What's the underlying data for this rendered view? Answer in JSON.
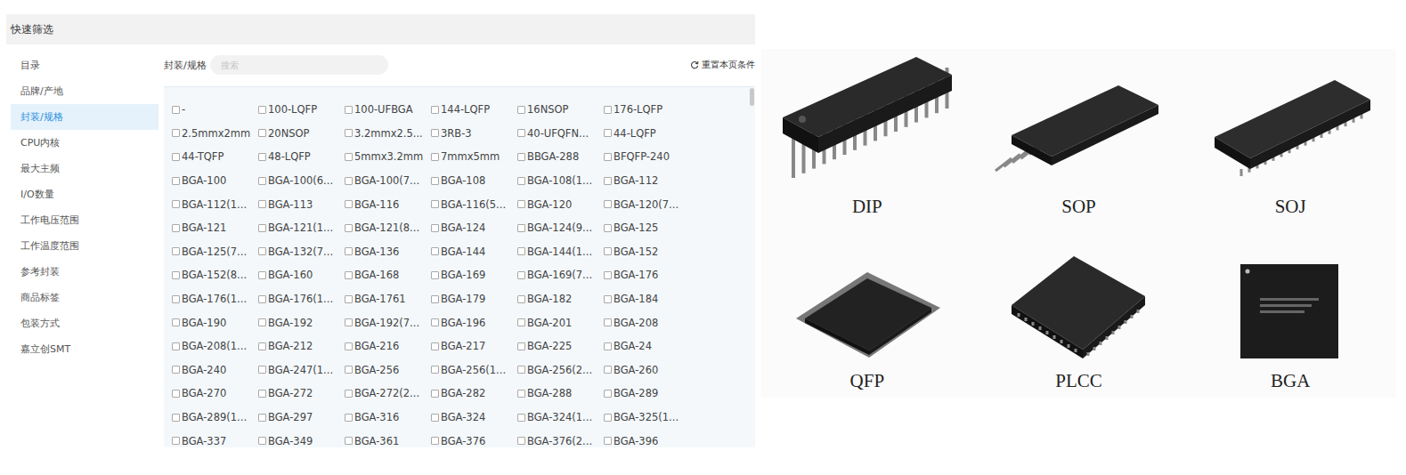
{
  "header": {
    "title": "快速筛选"
  },
  "sidebar": {
    "items": [
      {
        "label": "目录",
        "selected": false
      },
      {
        "label": "品牌/产地",
        "selected": false
      },
      {
        "label": "封装/规格",
        "selected": true
      },
      {
        "label": "CPU内核",
        "selected": false
      },
      {
        "label": "最大主频",
        "selected": false
      },
      {
        "label": "I/O数量",
        "selected": false
      },
      {
        "label": "工作电压范围",
        "selected": false
      },
      {
        "label": "工作温度范围",
        "selected": false
      },
      {
        "label": "参考封装",
        "selected": false
      },
      {
        "label": "商品标签",
        "selected": false
      },
      {
        "label": "包装方式",
        "selected": false
      },
      {
        "label": "嘉立创SMT",
        "selected": false
      }
    ]
  },
  "filter": {
    "label": "封装/规格",
    "search": {
      "placeholder": "搜索"
    },
    "reset": {
      "label": "重置本页条件"
    }
  },
  "grid": {
    "rows": [
      [
        {
          "label": "-",
          "checked": false
        },
        {
          "label": "100-LQFP",
          "checked": false
        },
        {
          "label": "100-UFBGA",
          "checked": false
        },
        {
          "label": "144-LQFP",
          "checked": false
        },
        {
          "label": "16NSOP",
          "checked": false
        },
        {
          "label": "176-LQFP",
          "checked": false
        }
      ],
      [
        {
          "label": "2.5mmx2mm",
          "checked": false
        },
        {
          "label": "20NSOP",
          "checked": false
        },
        {
          "label": "3.2mmx2.5...",
          "checked": false
        },
        {
          "label": "3RB-3",
          "checked": false
        },
        {
          "label": "40-UFQFN...",
          "checked": false
        },
        {
          "label": "44-LQFP",
          "checked": false
        }
      ],
      [
        {
          "label": "44-TQFP",
          "checked": false
        },
        {
          "label": "48-LQFP",
          "checked": false
        },
        {
          "label": "5mmx3.2mm",
          "checked": false
        },
        {
          "label": "7mmx5mm",
          "checked": false
        },
        {
          "label": "BBGA-288",
          "checked": false
        },
        {
          "label": "BFQFP-240",
          "checked": false
        }
      ],
      [
        {
          "label": "BGA-100",
          "checked": false
        },
        {
          "label": "BGA-100(6...",
          "checked": false
        },
        {
          "label": "BGA-100(7...",
          "checked": false
        },
        {
          "label": "BGA-108",
          "checked": false
        },
        {
          "label": "BGA-108(1...",
          "checked": false
        },
        {
          "label": "BGA-112",
          "checked": false
        }
      ],
      [
        {
          "label": "BGA-112(1...",
          "checked": false
        },
        {
          "label": "BGA-113",
          "checked": false
        },
        {
          "label": "BGA-116",
          "checked": false
        },
        {
          "label": "BGA-116(5...",
          "checked": false
        },
        {
          "label": "BGA-120",
          "checked": false
        },
        {
          "label": "BGA-120(7...",
          "checked": false
        }
      ],
      [
        {
          "label": "BGA-121",
          "checked": false
        },
        {
          "label": "BGA-121(1...",
          "checked": false
        },
        {
          "label": "BGA-121(8...",
          "checked": false
        },
        {
          "label": "BGA-124",
          "checked": false
        },
        {
          "label": "BGA-124(9...",
          "checked": false
        },
        {
          "label": "BGA-125",
          "checked": false
        }
      ],
      [
        {
          "label": "BGA-125(7...",
          "checked": false
        },
        {
          "label": "BGA-132(7...",
          "checked": false
        },
        {
          "label": "BGA-136",
          "checked": false
        },
        {
          "label": "BGA-144",
          "checked": false
        },
        {
          "label": "BGA-144(1...",
          "checked": false
        },
        {
          "label": "BGA-152",
          "checked": false
        }
      ],
      [
        {
          "label": "BGA-152(8...",
          "checked": false
        },
        {
          "label": "BGA-160",
          "checked": false
        },
        {
          "label": "BGA-168",
          "checked": false
        },
        {
          "label": "BGA-169",
          "checked": false
        },
        {
          "label": "BGA-169(7...",
          "checked": false
        },
        {
          "label": "BGA-176",
          "checked": false
        }
      ],
      [
        {
          "label": "BGA-176(1...",
          "checked": false
        },
        {
          "label": "BGA-176(1...",
          "checked": false
        },
        {
          "label": "BGA-1761",
          "checked": false
        },
        {
          "label": "BGA-179",
          "checked": false
        },
        {
          "label": "BGA-182",
          "checked": false
        },
        {
          "label": "BGA-184",
          "checked": false
        }
      ],
      [
        {
          "label": "BGA-190",
          "checked": false
        },
        {
          "label": "BGA-192",
          "checked": false
        },
        {
          "label": "BGA-192(7...",
          "checked": false
        },
        {
          "label": "BGA-196",
          "checked": false
        },
        {
          "label": "BGA-201",
          "checked": false
        },
        {
          "label": "BGA-208",
          "checked": false
        }
      ],
      [
        {
          "label": "BGA-208(1...",
          "checked": false
        },
        {
          "label": "BGA-212",
          "checked": false
        },
        {
          "label": "BGA-216",
          "checked": false
        },
        {
          "label": "BGA-217",
          "checked": false
        },
        {
          "label": "BGA-225",
          "checked": false
        },
        {
          "label": "BGA-24",
          "checked": false
        }
      ],
      [
        {
          "label": "BGA-240",
          "checked": false
        },
        {
          "label": "BGA-247(1...",
          "checked": false
        },
        {
          "label": "BGA-256",
          "checked": false
        },
        {
          "label": "BGA-256(1...",
          "checked": false
        },
        {
          "label": "BGA-256(2...",
          "checked": false
        },
        {
          "label": "BGA-260",
          "checked": false
        }
      ],
      [
        {
          "label": "BGA-270",
          "checked": false
        },
        {
          "label": "BGA-272",
          "checked": false
        },
        {
          "label": "BGA-272(2...",
          "checked": false
        },
        {
          "label": "BGA-282",
          "checked": false
        },
        {
          "label": "BGA-288",
          "checked": false
        },
        {
          "label": "BGA-289",
          "checked": false
        }
      ],
      [
        {
          "label": "BGA-289(1...",
          "checked": false
        },
        {
          "label": "BGA-297",
          "checked": false
        },
        {
          "label": "BGA-316",
          "checked": false
        },
        {
          "label": "BGA-324",
          "checked": false
        },
        {
          "label": "BGA-324(1...",
          "checked": false
        },
        {
          "label": "BGA-325(1...",
          "checked": false
        }
      ],
      [
        {
          "label": "BGA-337",
          "checked": false
        },
        {
          "label": "BGA-349",
          "checked": false
        },
        {
          "label": "BGA-361",
          "checked": false
        },
        {
          "label": "BGA-376",
          "checked": false
        },
        {
          "label": "BGA-376(2...",
          "checked": false
        },
        {
          "label": "BGA-396",
          "checked": false
        }
      ]
    ]
  },
  "figure": {
    "items": [
      {
        "label": "DIP",
        "kind": "dip"
      },
      {
        "label": "SOP",
        "kind": "sop"
      },
      {
        "label": "SOJ",
        "kind": "soj"
      },
      {
        "label": "QFP",
        "kind": "qfp"
      },
      {
        "label": "PLCC",
        "kind": "plcc"
      },
      {
        "label": "BGA",
        "kind": "bga"
      }
    ]
  }
}
